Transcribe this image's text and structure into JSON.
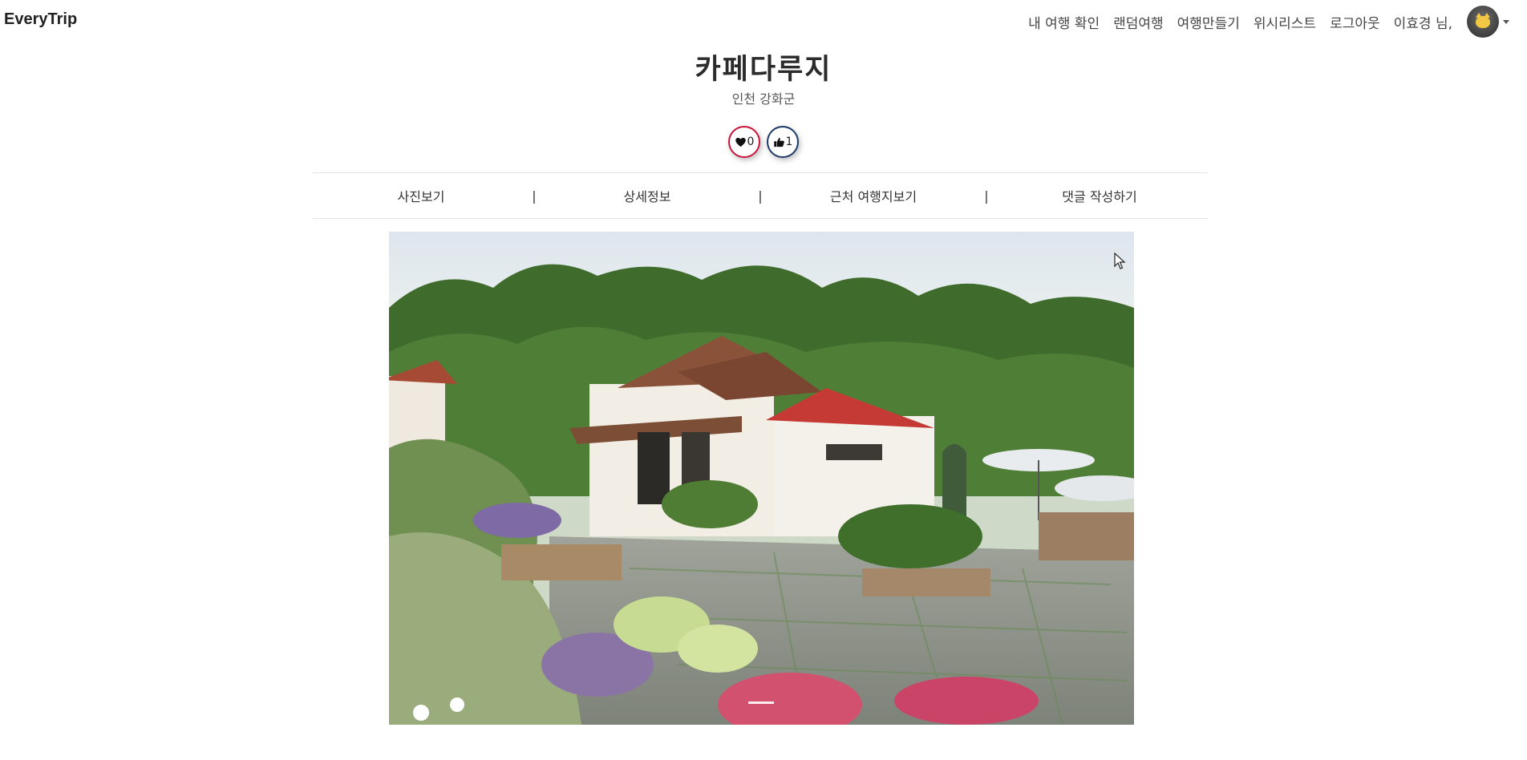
{
  "navbar": {
    "brand": "EveryTrip",
    "links": [
      "내 여행 확인",
      "랜덤여행",
      "여행만들기",
      "위시리스트",
      "로그아웃"
    ],
    "user_greeting": "이효경 님,",
    "avatar_icon": "cat-avatar-icon",
    "dropdown_icon": "chevron-down-icon"
  },
  "place": {
    "title": "카페다루지",
    "region": "인천 강화군"
  },
  "reactions": {
    "like_count": "0",
    "like_icon": "heart-icon",
    "like_color": "#c8153c",
    "thumb_count": "1",
    "thumb_icon": "thumbs-up-icon",
    "thumb_color": "#1e3a68"
  },
  "tabs": {
    "items": [
      "사진보기",
      "상세정보",
      "근처 여행지보기",
      "댓글 작성하기"
    ],
    "separator": "|"
  },
  "carousel": {
    "photo_subject": "garden-cafe-photo",
    "active_slide": 1,
    "total_slides": 1
  }
}
